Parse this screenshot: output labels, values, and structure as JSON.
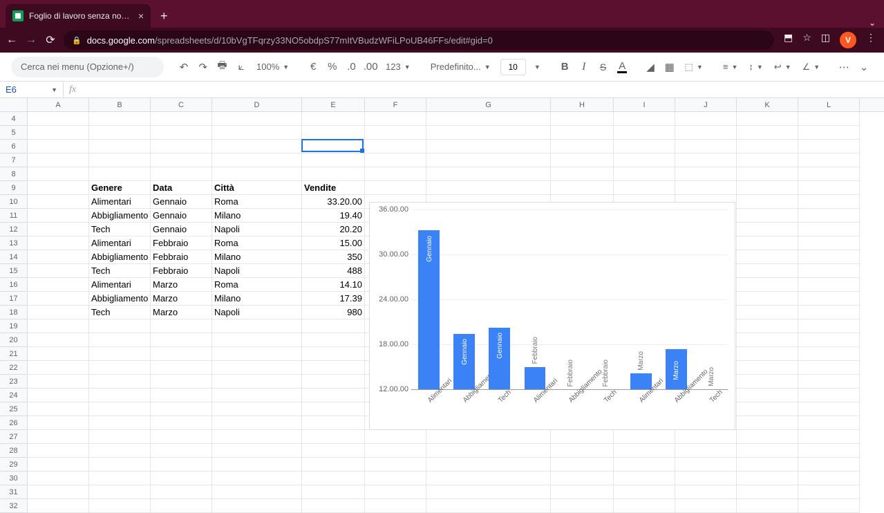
{
  "browser": {
    "tab_title": "Foglio di lavoro senza nome - F",
    "url_domain": "docs.google.com",
    "url_path": "/spreadsheets/d/10bVgTFqrzy33NO5obdpS77mItVBudzWFiLPoUB46FFs/edit#gid=0",
    "avatar_letter": "V"
  },
  "toolbar": {
    "search_placeholder": "Cerca nei menu (Opzione+/)",
    "zoom": "100%",
    "font_family": "Predefinito...",
    "font_size": "10",
    "decimal_dec": ".0",
    "decimal_inc": ".00",
    "format_123": "123",
    "euro": "€",
    "percent": "%",
    "bold": "B",
    "italic": "I",
    "strike": "S",
    "text_A": "A",
    "more": "⋯"
  },
  "namebox": "E6",
  "columns": [
    "A",
    "B",
    "C",
    "D",
    "E",
    "F",
    "G",
    "H",
    "I",
    "J",
    "K",
    "L"
  ],
  "row_start": 4,
  "row_count": 29,
  "headers": {
    "b9": "Genere",
    "c9": "Data",
    "d9": "Città",
    "e9": "Vendite"
  },
  "table": [
    {
      "genere": "Alimentari",
      "data": "Gennaio",
      "citta": "Roma",
      "vendite": "33.20.00"
    },
    {
      "genere": "Abbigliamento",
      "data": "Gennaio",
      "citta": "Milano",
      "vendite": "19.40"
    },
    {
      "genere": "Tech",
      "data": "Gennaio",
      "citta": "Napoli",
      "vendite": "20.20"
    },
    {
      "genere": "Alimentari",
      "data": "Febbraio",
      "citta": "Roma",
      "vendite": "15.00"
    },
    {
      "genere": "Abbigliamento",
      "data": "Febbraio",
      "citta": "Milano",
      "vendite": "350"
    },
    {
      "genere": "Tech",
      "data": "Febbraio",
      "citta": "Napoli",
      "vendite": "488"
    },
    {
      "genere": "Alimentari",
      "data": "Marzo",
      "citta": "Roma",
      "vendite": "14.10"
    },
    {
      "genere": "Abbigliamento",
      "data": "Marzo",
      "citta": "Milano",
      "vendite": "17.39"
    },
    {
      "genere": "Tech",
      "data": "Marzo",
      "citta": "Napoli",
      "vendite": "980"
    }
  ],
  "selected_cell": "E6",
  "chart_data": {
    "type": "bar",
    "y_ticks": [
      "12.00.00",
      "18.00.00",
      "24.00.00",
      "30.00.00",
      "36.00.00"
    ],
    "y_range": [
      12,
      36
    ],
    "series": [
      {
        "x": "Alimentari",
        "month": "Gennaio",
        "value": 33.2
      },
      {
        "x": "Abbigliamento",
        "month": "Gennaio",
        "value": 19.4
      },
      {
        "x": "Tech",
        "month": "Gennaio",
        "value": 20.2
      },
      {
        "x": "Alimentari",
        "month": "Febbraio",
        "value": 15.0
      },
      {
        "x": "Abbigliamento",
        "month": "Febbraio",
        "value": null
      },
      {
        "x": "Tech",
        "month": "Febbraio",
        "value": null
      },
      {
        "x": "Alimentari",
        "month": "Marzo",
        "value": 14.1
      },
      {
        "x": "Abbigliamento",
        "month": "Marzo",
        "value": 17.39
      },
      {
        "x": "Tech",
        "month": "Marzo",
        "value": null
      }
    ]
  }
}
